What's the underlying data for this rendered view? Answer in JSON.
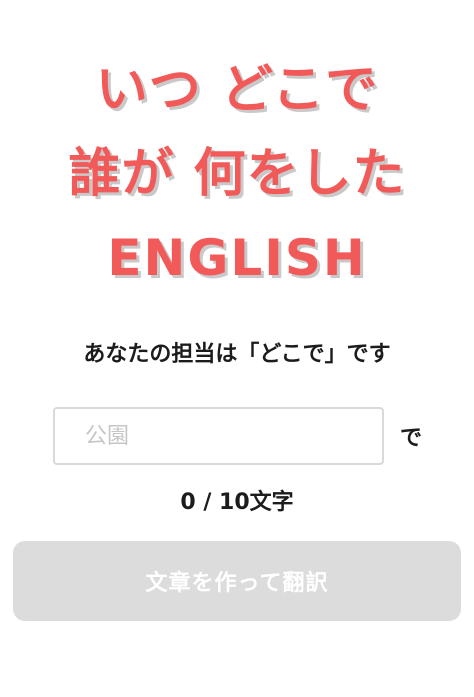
{
  "title": {
    "line1": "いつ どこで",
    "line2": "誰が 何をした",
    "line3": "ENGLISH"
  },
  "prompt": "あなたの担当は「どこで」です",
  "input": {
    "value": "",
    "placeholder": "公園",
    "suffix": "で"
  },
  "counter": "0 / 10文字",
  "submit_label": "文章を作って翻訳",
  "colors": {
    "title": "#f25a5a",
    "button_disabled": "#dcdcdc"
  }
}
